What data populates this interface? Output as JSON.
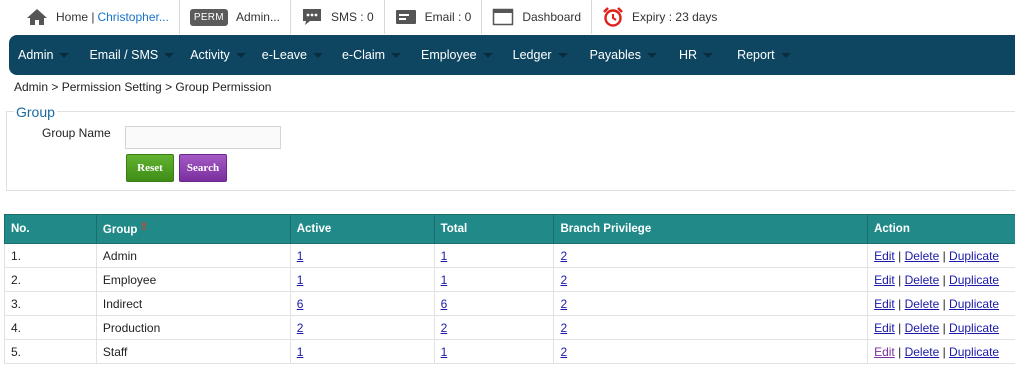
{
  "topbar": {
    "home_label": "Home | ",
    "user_name": "Christopher...",
    "perm_badge": "PERM",
    "admin_label": "Admin...",
    "sms_label": "SMS : 0",
    "email_label": "Email : 0",
    "dashboard_label": "Dashboard",
    "expiry_label": "Expiry : 23 days"
  },
  "nav": {
    "items": [
      "Admin",
      "Email / SMS",
      "Activity",
      "e-Leave",
      "e-Claim",
      "Employee",
      "Ledger",
      "Payables",
      "HR",
      "Report"
    ]
  },
  "breadcrumb": "Admin > Permission Setting > Group Permission",
  "group_form": {
    "legend": "Group",
    "group_name_label": "Group Name",
    "group_name_value": "",
    "reset_label": "Reset",
    "search_label": "Search"
  },
  "table": {
    "headers": [
      "No.",
      "Group",
      "Active",
      "Total",
      "Branch Privilege",
      "Action"
    ],
    "sort_indicator": "⇧",
    "rows": [
      {
        "no": "1.",
        "group": "Admin",
        "active": "1",
        "total": "1",
        "branch": "2"
      },
      {
        "no": "2.",
        "group": "Employee",
        "active": "1",
        "total": "1",
        "branch": "2"
      },
      {
        "no": "3.",
        "group": "Indirect",
        "active": "6",
        "total": "6",
        "branch": "2"
      },
      {
        "no": "4.",
        "group": "Production",
        "active": "2",
        "total": "2",
        "branch": "2"
      },
      {
        "no": "5.",
        "group": "Staff",
        "active": "1",
        "total": "1",
        "branch": "2"
      }
    ],
    "actions": {
      "edit": "Edit",
      "delete": "Delete",
      "duplicate": "Duplicate",
      "sep": " | "
    }
  },
  "colors": {
    "navbar": "#0e4662",
    "table_header": "#218a88",
    "reset_button": "#4f9f22",
    "search_button": "#8b3fb0",
    "legend": "#1b6aa0"
  }
}
